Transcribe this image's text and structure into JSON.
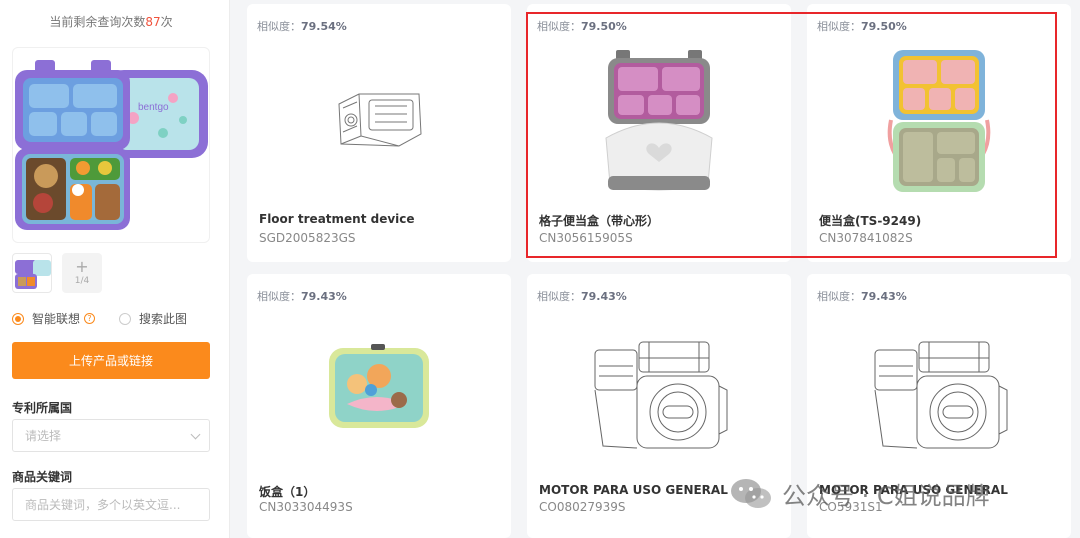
{
  "sidebar": {
    "quota_prefix": "当前剩余查询次数",
    "quota_count": "87",
    "quota_suffix": "次",
    "thumb_counter": "1/4",
    "modes": [
      {
        "label": "智能联想",
        "selected": true
      },
      {
        "label": "搜索此图",
        "selected": false
      }
    ],
    "upload_label": "上传产品或链接",
    "country_label": "专利所属国",
    "country_placeholder": "请选择",
    "keyword_label": "商品关键词",
    "keyword_placeholder": "商品关键词，多个以英文逗..."
  },
  "results": [
    {
      "sim_label": "相似度：",
      "sim": "79.54%",
      "title": "Floor treatment device",
      "code": "SGD2005823GS",
      "image": "floor-device-drawing"
    },
    {
      "sim_label": "相似度：",
      "sim": "79.50%",
      "title": "格子便当盒（带心形）",
      "code": "CN305615905S",
      "image": "heart-bento-box"
    },
    {
      "sim_label": "相似度：",
      "sim": "79.50%",
      "title": "便当盒(TS-9249)",
      "code": "CN307841082S",
      "image": "colorful-bento-box"
    },
    {
      "sim_label": "相似度：",
      "sim": "79.43%",
      "title": "饭盒（1）",
      "code": "CN303304493S",
      "image": "cartoon-lunch-box"
    },
    {
      "sim_label": "相似度：",
      "sim": "79.43%",
      "title": "MOTOR PARA USO GENERAL",
      "code": "CO08027939S",
      "image": "motor-drawing"
    },
    {
      "sim_label": "相似度：",
      "sim": "79.43%",
      "title": "MOTOR PARA USO GENERAL",
      "code": "CO5931S1",
      "image": "motor-drawing"
    }
  ],
  "watermark": "公众号 · C姐说品牌",
  "colors": {
    "accent": "#fb8a1c",
    "highlight": "#e8262a",
    "quota_number": "#f0533d"
  }
}
